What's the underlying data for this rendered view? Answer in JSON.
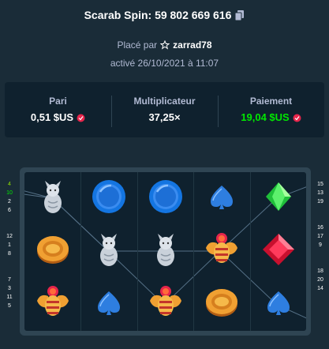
{
  "header": {
    "title": "Scarab Spin: 59 802 669 616",
    "placed_prefix": "Placé par",
    "user": "zarrad78",
    "activated": "activé 26/10/2021 à 11:07"
  },
  "stats": {
    "bet": {
      "label": "Pari",
      "value": "0,51 $US"
    },
    "multiplier": {
      "label": "Multiplicateur",
      "value": "37,25×"
    },
    "payout": {
      "label": "Paiement",
      "value": "19,04 $US"
    }
  },
  "currency_icon": "usd-coin-icon",
  "colors": {
    "payout": "#00e701",
    "highlight_line_4": "#8ee000",
    "highlight_line_10": "#00e701"
  },
  "reels": [
    [
      "rat",
      "coin",
      "scarab"
    ],
    [
      "blue-orb",
      "rat",
      "spade"
    ],
    [
      "blue-orb",
      "rat",
      "scarab"
    ],
    [
      "spade",
      "scarab",
      "coin"
    ],
    [
      "green-gem",
      "red-gem",
      "spade"
    ]
  ],
  "left_lines": [
    "4",
    "10",
    "2",
    "6",
    "",
    "",
    "12",
    "1",
    "8",
    "",
    "",
    "7",
    "3",
    "11",
    "5"
  ],
  "right_lines": [
    "15",
    "13",
    "19",
    "",
    "",
    "16",
    "17",
    "9",
    "",
    "",
    "18",
    "20",
    "14"
  ],
  "highlighted_lines": [
    "4",
    "10"
  ]
}
